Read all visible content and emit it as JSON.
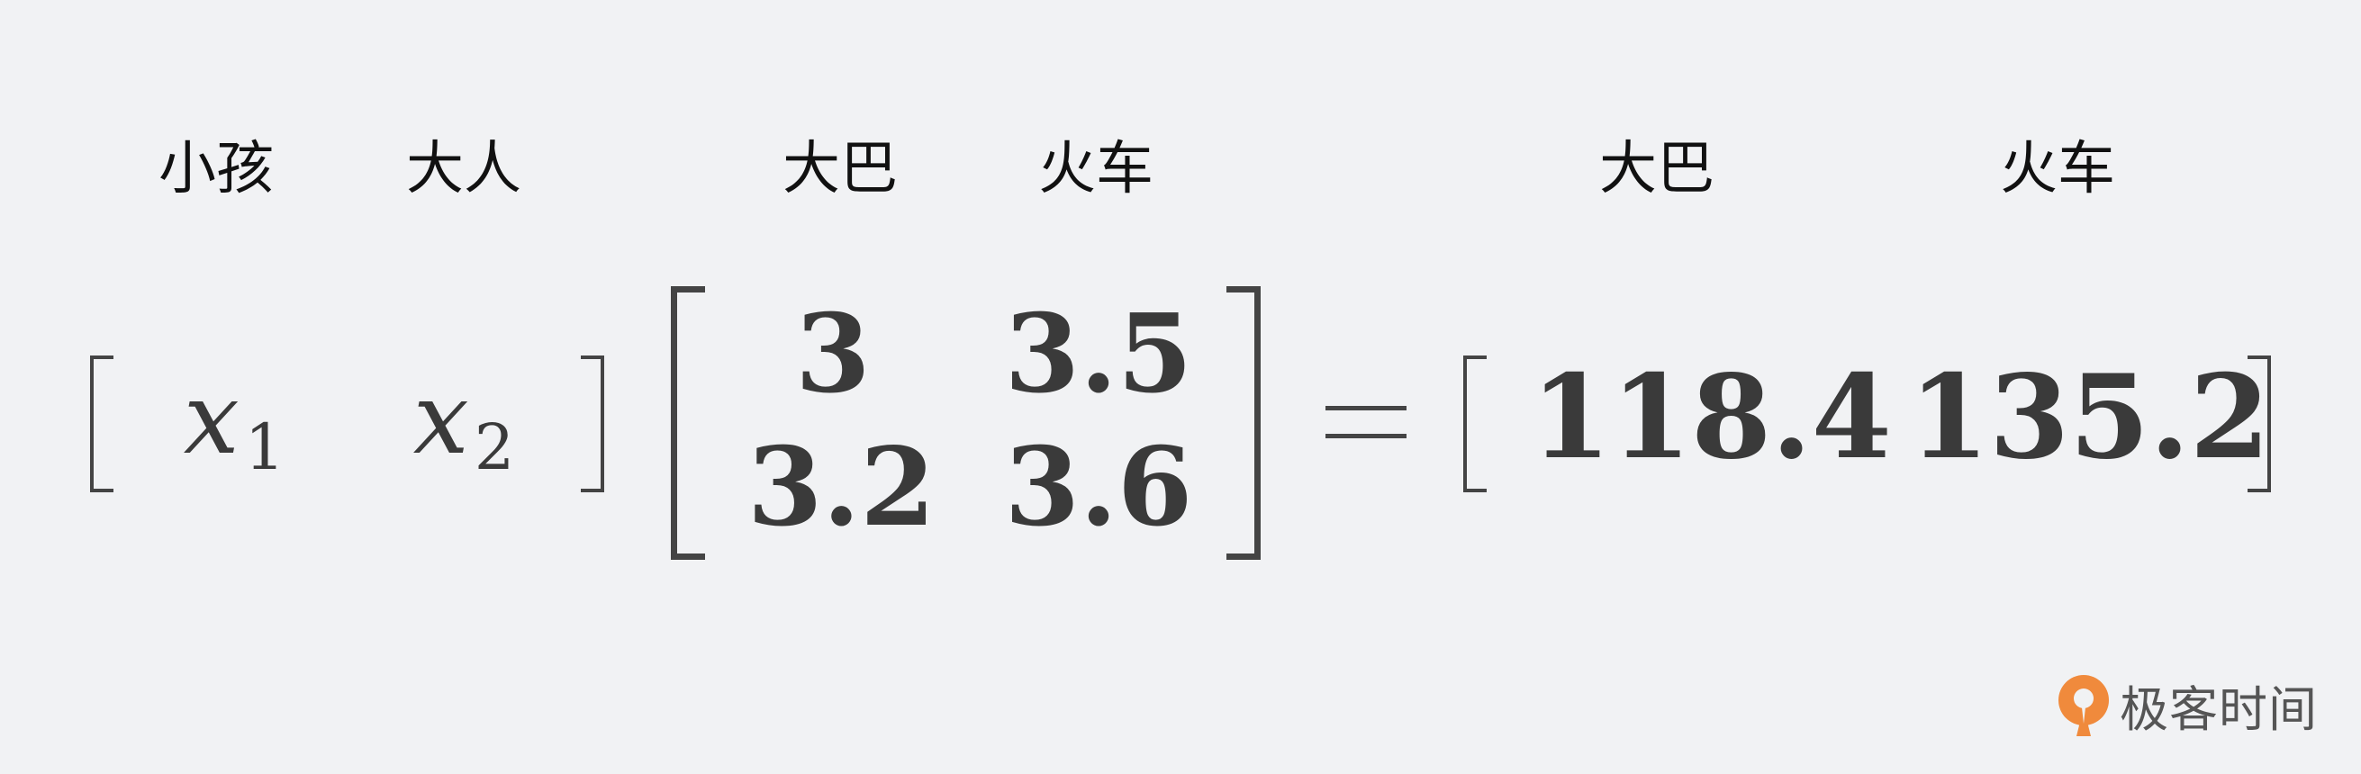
{
  "labels": {
    "child": "小孩",
    "adult": "大人",
    "matrix_col1": "大巴",
    "matrix_col2": "火车",
    "result_col1": "大巴",
    "result_col2": "火车"
  },
  "vector": {
    "x1_base": "x",
    "x1_sub": "1",
    "x2_base": "x",
    "x2_sub": "2"
  },
  "matrix": {
    "r1c1": "3",
    "r1c2": "3.5",
    "r2c1": "3.2",
    "r2c2": "3.6"
  },
  "equals": "=",
  "result": {
    "v1": "118.4",
    "v2": "135.2"
  },
  "logo": {
    "text": "极客时间",
    "accent_color": "#f08a3c"
  }
}
